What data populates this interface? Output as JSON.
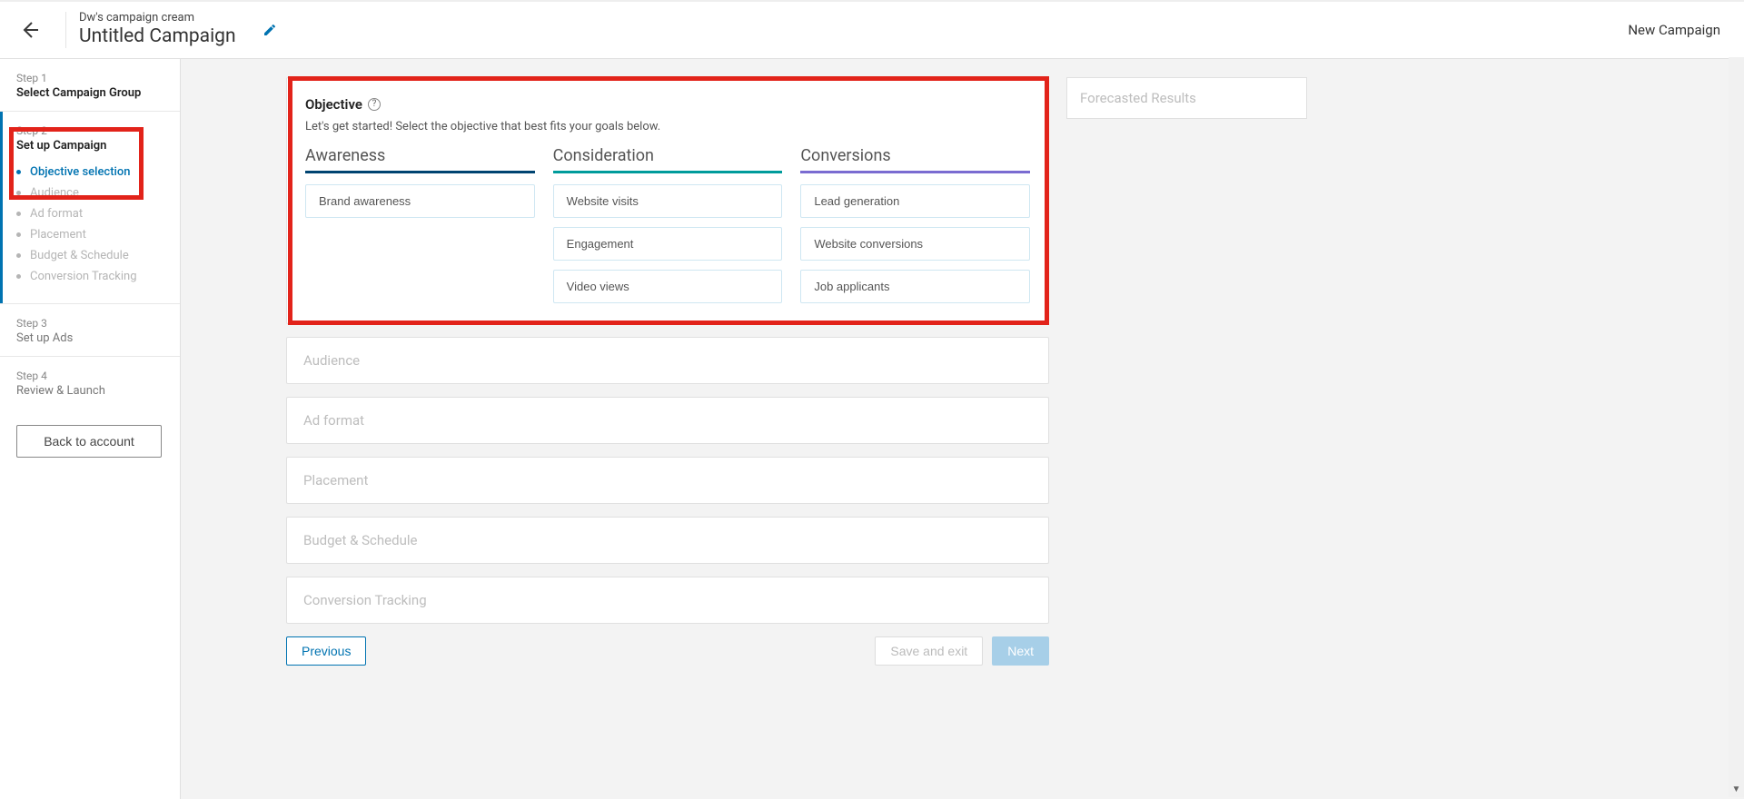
{
  "header": {
    "breadcrumb": "Dw's campaign cream",
    "title": "Untitled Campaign",
    "right_label": "New Campaign"
  },
  "sidebar": {
    "step1": {
      "label": "Step 1",
      "title": "Select Campaign Group"
    },
    "step2": {
      "label": "Step 2",
      "title": "Set up Campaign",
      "items": [
        {
          "label": "Objective selection",
          "active": true
        },
        {
          "label": "Audience"
        },
        {
          "label": "Ad format"
        },
        {
          "label": "Placement"
        },
        {
          "label": "Budget & Schedule"
        },
        {
          "label": "Conversion Tracking"
        }
      ]
    },
    "step3": {
      "label": "Step 3",
      "title": "Set up Ads"
    },
    "step4": {
      "label": "Step 4",
      "title": "Review & Launch"
    },
    "back_button": "Back to account"
  },
  "objective": {
    "title": "Objective",
    "subtitle": "Let's get started! Select the objective that best fits your goals below.",
    "columns": [
      {
        "title": "Awareness",
        "color": "awareness",
        "options": [
          "Brand awareness"
        ]
      },
      {
        "title": "Consideration",
        "color": "consideration",
        "options": [
          "Website visits",
          "Engagement",
          "Video views"
        ]
      },
      {
        "title": "Conversions",
        "color": "conversions",
        "options": [
          "Lead generation",
          "Website conversions",
          "Job applicants"
        ]
      }
    ]
  },
  "collapsed_sections": [
    "Audience",
    "Ad format",
    "Placement",
    "Budget & Schedule",
    "Conversion Tracking"
  ],
  "footer": {
    "previous": "Previous",
    "save": "Save and exit",
    "next": "Next"
  },
  "right_panel": {
    "title": "Forecasted Results"
  },
  "help_glyph": "?"
}
